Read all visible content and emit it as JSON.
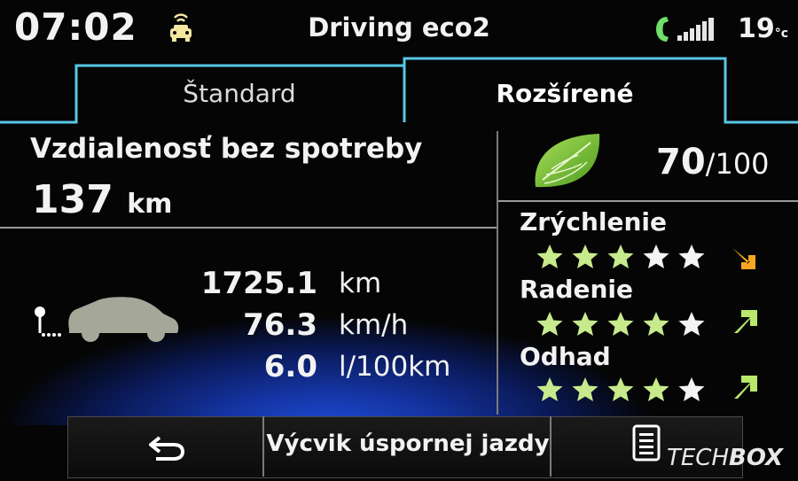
{
  "status": {
    "time": "07:02",
    "title": "Driving eco2",
    "temperature": "19",
    "temperature_unit": "°c"
  },
  "tabs": [
    {
      "label": "Štandard",
      "active": false
    },
    {
      "label": "Rozšírené",
      "active": true
    }
  ],
  "distance": {
    "label": "Vzdialenosť bez spotreby",
    "value": "137",
    "unit": "km"
  },
  "eco_score": {
    "value": "70",
    "max": "/100"
  },
  "trip": [
    {
      "value": "1725.1",
      "unit": "km"
    },
    {
      "value": "76.3",
      "unit": "km/h"
    },
    {
      "value": "6.0",
      "unit": "l/100km"
    }
  ],
  "criteria": [
    {
      "label": "Zrýchlenie",
      "stars": 3,
      "max_stars": 5,
      "trend": "down",
      "trend_color": "#f5a623"
    },
    {
      "label": "Radenie",
      "stars": 4,
      "max_stars": 5,
      "trend": "up",
      "trend_color": "#b9e86a"
    },
    {
      "label": "Odhad",
      "stars": 4,
      "max_stars": 5,
      "trend": "up",
      "trend_color": "#b9e86a"
    }
  ],
  "bottom": {
    "label": "Výcvik úspornej jazdy"
  },
  "watermark": {
    "part1": "TECH",
    "part2": "BOX"
  },
  "colors": {
    "accent_cyan": "#59c7e6",
    "star_on": "#c6ea8c",
    "star_off": "#f4f4f4",
    "leaf_green": "#7cc23a"
  },
  "icons": {
    "status_car": "car-signal-icon",
    "phone": "phone-icon",
    "signal": "signal-strength-icon",
    "leaf": "eco-leaf-icon",
    "pin": "route-pin-icon",
    "car": "car-silhouette-icon",
    "back": "back-arrow-icon",
    "doc": "document-icon"
  }
}
